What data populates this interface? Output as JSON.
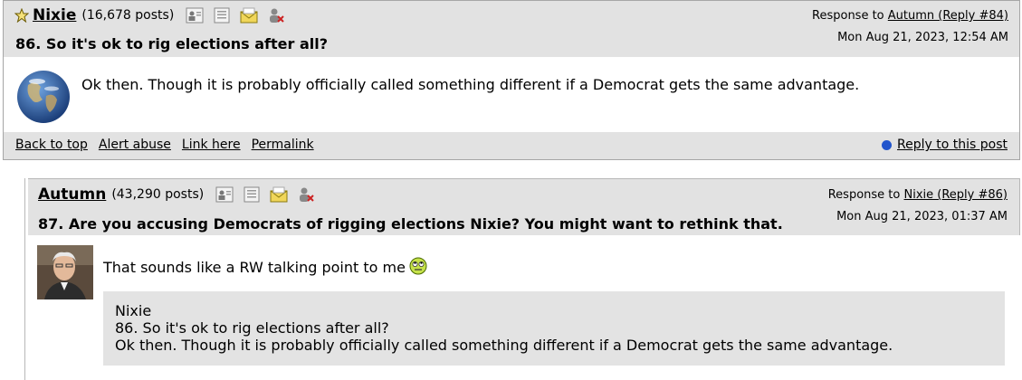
{
  "posts": [
    {
      "author": "Nixie",
      "post_count": "(16,678 posts)",
      "subject": "86. So it's ok to rig elections after all?",
      "response_prefix": "Response to",
      "response_link": "Autumn (Reply #84)",
      "timestamp": "Mon Aug 21, 2023, 12:54 AM",
      "body": "Ok then. Though it is probably officially called something different if a Democrat gets the same advantage.",
      "footer_links": [
        "Back to top",
        "Alert abuse",
        "Link here",
        "Permalink"
      ],
      "reply_label": "Reply to this post",
      "avatar_icon": "earth-avatar"
    },
    {
      "author": "Autumn",
      "post_count": "(43,290 posts)",
      "subject": "87. Are you accusing Democrats of rigging elections Nixie? You might want to rethink that.",
      "response_prefix": "Response to",
      "response_link": "Nixie (Reply #86)",
      "timestamp": "Mon Aug 21, 2023, 01:37 AM",
      "body": "That sounds like a RW talking point to me",
      "emoji_icon": "eye-roll-smiley-icon",
      "avatar_icon": "person-photo-avatar",
      "quote": {
        "author": "Nixie",
        "subject": "86. So it's ok to rig elections after all?",
        "body": "Ok then. Though it is probably officially called something different if a Democrat gets the same advantage."
      }
    }
  ],
  "icon_names": [
    "profile-icon",
    "journal-icon",
    "send-message-icon",
    "ignore-user-icon"
  ],
  "colors": {
    "header_bg": "#e2e2e2",
    "quote_bg": "#e3e3e3",
    "reply_dot": "#2255cc"
  }
}
